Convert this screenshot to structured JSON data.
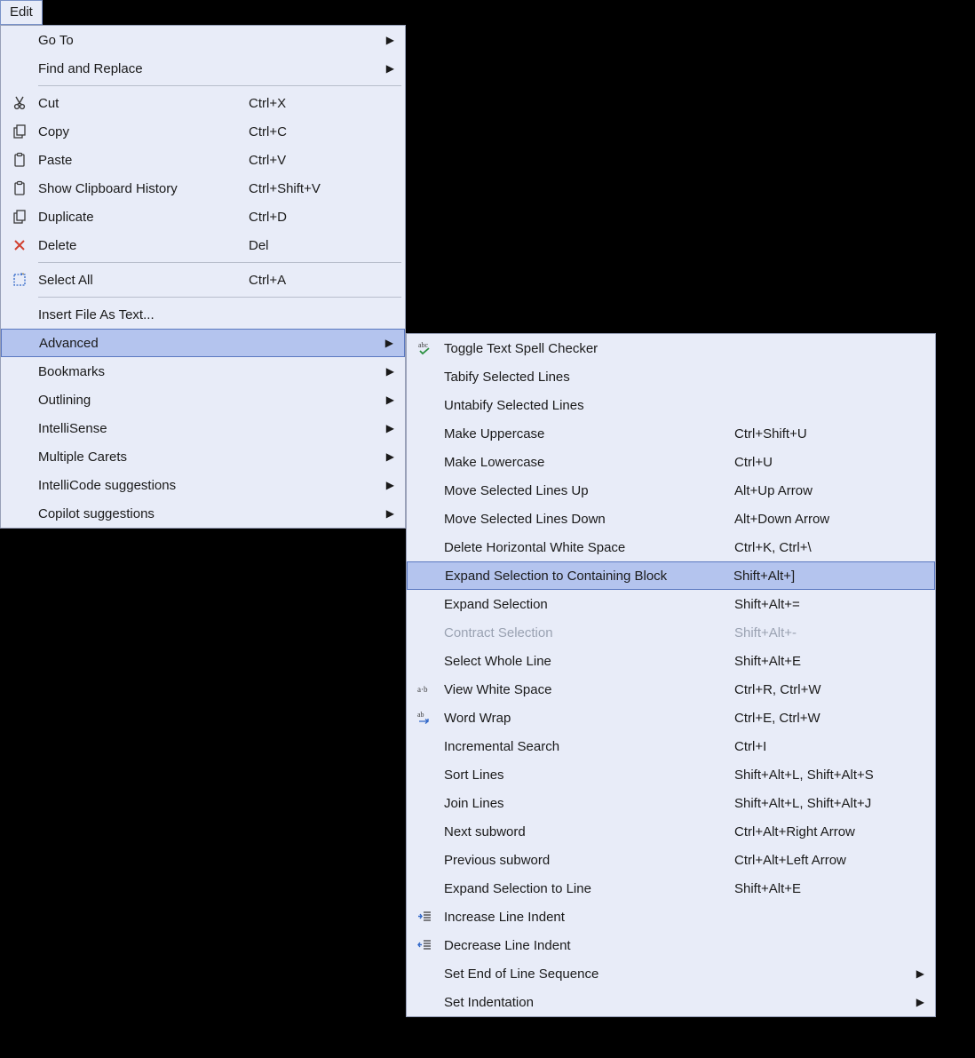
{
  "menubar": {
    "edit": "Edit"
  },
  "main": [
    {
      "id": "goto",
      "label": "Go To",
      "shortcut": "",
      "submenu": true,
      "icon": "",
      "sepAfter": false
    },
    {
      "id": "findreplace",
      "label": "Find and Replace",
      "shortcut": "",
      "submenu": true,
      "icon": "",
      "sepAfter": true
    },
    {
      "id": "cut",
      "label": "Cut",
      "shortcut": "Ctrl+X",
      "submenu": false,
      "icon": "cut",
      "sepAfter": false
    },
    {
      "id": "copy",
      "label": "Copy",
      "shortcut": "Ctrl+C",
      "submenu": false,
      "icon": "copy",
      "sepAfter": false
    },
    {
      "id": "paste",
      "label": "Paste",
      "shortcut": "Ctrl+V",
      "submenu": false,
      "icon": "paste",
      "sepAfter": false
    },
    {
      "id": "cliphist",
      "label": "Show Clipboard History",
      "shortcut": "Ctrl+Shift+V",
      "submenu": false,
      "icon": "paste",
      "sepAfter": false
    },
    {
      "id": "duplicate",
      "label": "Duplicate",
      "shortcut": "Ctrl+D",
      "submenu": false,
      "icon": "copy",
      "sepAfter": false
    },
    {
      "id": "delete",
      "label": "Delete",
      "shortcut": "Del",
      "submenu": false,
      "icon": "delete",
      "sepAfter": true
    },
    {
      "id": "selectall",
      "label": "Select All",
      "shortcut": "Ctrl+A",
      "submenu": false,
      "icon": "selectall",
      "sepAfter": true
    },
    {
      "id": "insertfile",
      "label": "Insert File As Text...",
      "shortcut": "",
      "submenu": false,
      "icon": "",
      "sepAfter": false
    },
    {
      "id": "advanced",
      "label": "Advanced",
      "shortcut": "",
      "submenu": true,
      "icon": "",
      "sepAfter": false,
      "highlight": true
    },
    {
      "id": "bookmarks",
      "label": "Bookmarks",
      "shortcut": "",
      "submenu": true,
      "icon": "",
      "sepAfter": false
    },
    {
      "id": "outlining",
      "label": "Outlining",
      "shortcut": "",
      "submenu": true,
      "icon": "",
      "sepAfter": false
    },
    {
      "id": "intellisense",
      "label": "IntelliSense",
      "shortcut": "",
      "submenu": true,
      "icon": "",
      "sepAfter": false
    },
    {
      "id": "multcarets",
      "label": "Multiple Carets",
      "shortcut": "",
      "submenu": true,
      "icon": "",
      "sepAfter": false
    },
    {
      "id": "intellicode",
      "label": "IntelliCode suggestions",
      "shortcut": "",
      "submenu": true,
      "icon": "",
      "sepAfter": false
    },
    {
      "id": "copilot",
      "label": "Copilot suggestions",
      "shortcut": "",
      "submenu": true,
      "icon": "",
      "sepAfter": false
    }
  ],
  "sub": [
    {
      "id": "spellcheck",
      "label": "Toggle Text Spell Checker",
      "shortcut": "",
      "submenu": false,
      "icon": "spell",
      "sepAfter": false
    },
    {
      "id": "tabify",
      "label": "Tabify Selected Lines",
      "shortcut": "",
      "submenu": false,
      "icon": "",
      "sepAfter": false
    },
    {
      "id": "untabify",
      "label": "Untabify Selected Lines",
      "shortcut": "",
      "submenu": false,
      "icon": "",
      "sepAfter": false
    },
    {
      "id": "upper",
      "label": "Make Uppercase",
      "shortcut": "Ctrl+Shift+U",
      "submenu": false,
      "icon": "",
      "sepAfter": false
    },
    {
      "id": "lower",
      "label": "Make Lowercase",
      "shortcut": "Ctrl+U",
      "submenu": false,
      "icon": "",
      "sepAfter": false
    },
    {
      "id": "moveup",
      "label": "Move Selected Lines Up",
      "shortcut": "Alt+Up Arrow",
      "submenu": false,
      "icon": "",
      "sepAfter": false
    },
    {
      "id": "movedown",
      "label": "Move Selected Lines Down",
      "shortcut": "Alt+Down Arrow",
      "submenu": false,
      "icon": "",
      "sepAfter": false
    },
    {
      "id": "delws",
      "label": "Delete Horizontal White Space",
      "shortcut": "Ctrl+K, Ctrl+\\",
      "submenu": false,
      "icon": "",
      "sepAfter": false
    },
    {
      "id": "expblock",
      "label": "Expand Selection to Containing Block",
      "shortcut": "Shift+Alt+]",
      "submenu": false,
      "icon": "",
      "sepAfter": false,
      "highlight": true
    },
    {
      "id": "expsel",
      "label": "Expand Selection",
      "shortcut": "Shift+Alt+=",
      "submenu": false,
      "icon": "",
      "sepAfter": false
    },
    {
      "id": "contract",
      "label": "Contract Selection",
      "shortcut": "Shift+Alt+-",
      "submenu": false,
      "icon": "",
      "sepAfter": false,
      "disabled": true
    },
    {
      "id": "selline",
      "label": "Select Whole Line",
      "shortcut": "Shift+Alt+E",
      "submenu": false,
      "icon": "",
      "sepAfter": false
    },
    {
      "id": "viewws",
      "label": "View White Space",
      "shortcut": "Ctrl+R, Ctrl+W",
      "submenu": false,
      "icon": "viewws",
      "sepAfter": false
    },
    {
      "id": "wrap",
      "label": "Word Wrap",
      "shortcut": "Ctrl+E, Ctrl+W",
      "submenu": false,
      "icon": "wrap",
      "sepAfter": false
    },
    {
      "id": "incsearch",
      "label": "Incremental Search",
      "shortcut": "Ctrl+I",
      "submenu": false,
      "icon": "",
      "sepAfter": false
    },
    {
      "id": "sort",
      "label": "Sort Lines",
      "shortcut": "Shift+Alt+L, Shift+Alt+S",
      "submenu": false,
      "icon": "",
      "sepAfter": false
    },
    {
      "id": "join",
      "label": "Join Lines",
      "shortcut": "Shift+Alt+L, Shift+Alt+J",
      "submenu": false,
      "icon": "",
      "sepAfter": false
    },
    {
      "id": "nextsub",
      "label": "Next subword",
      "shortcut": "Ctrl+Alt+Right Arrow",
      "submenu": false,
      "icon": "",
      "sepAfter": false
    },
    {
      "id": "prevsub",
      "label": "Previous subword",
      "shortcut": "Ctrl+Alt+Left Arrow",
      "submenu": false,
      "icon": "",
      "sepAfter": false
    },
    {
      "id": "exptoline",
      "label": "Expand Selection to Line",
      "shortcut": "Shift+Alt+E",
      "submenu": false,
      "icon": "",
      "sepAfter": false
    },
    {
      "id": "incindent",
      "label": "Increase Line Indent",
      "shortcut": "",
      "submenu": false,
      "icon": "indentinc",
      "sepAfter": false
    },
    {
      "id": "decindent",
      "label": "Decrease Line Indent",
      "shortcut": "",
      "submenu": false,
      "icon": "indentdec",
      "sepAfter": false
    },
    {
      "id": "eolseq",
      "label": "Set End of Line Sequence",
      "shortcut": "",
      "submenu": true,
      "icon": "",
      "sepAfter": false
    },
    {
      "id": "setindent",
      "label": "Set Indentation",
      "shortcut": "",
      "submenu": true,
      "icon": "",
      "sepAfter": false
    }
  ]
}
